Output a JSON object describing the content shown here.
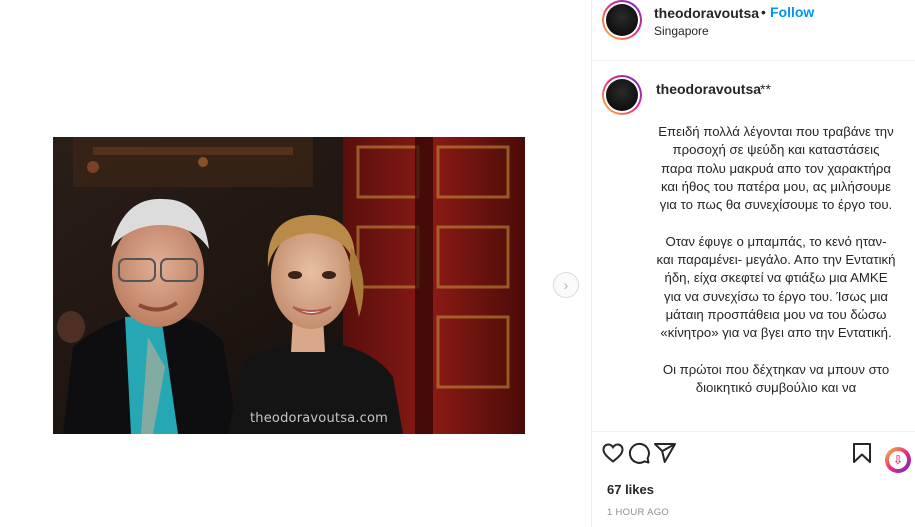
{
  "post": {
    "username": "theodoravoutsa",
    "follow_separator": "•",
    "follow_label": "Follow",
    "location": "Singapore",
    "photo_watermark": "theodoravoutsa.com",
    "next_arrow": "›"
  },
  "caption": {
    "username": "theodoravoutsa",
    "suffix": "**",
    "paragraphs": [
      "Επειδή πολλά λέγονται που τραβάνε την προσοχή σε ψεύδη και καταστάσεις παρα πολυ μακρυά απο τον χαρακτήρα και ήθος του πατέρα μου, ας μιλήσουμε για το πως θα συνεχίσουμε το έργο του.",
      "Οταν έφυγε ο μπαμπάς, το κενό ηταν- και παραμένει- μεγάλο. Απο την Εντατική ήδη, είχα σκεφτεί να φτιάξω μια ΑΜΚΕ για να συνεχίσω το έργο του. Ίσως μια μάταιη προσπάθεια μου να του δώσω «κίνητρο» για να βγει απο την Εντατική.",
      "Οι πρώτοι που δέχτηκαν να μπουν στο διοικητικό συμβούλιο και να"
    ]
  },
  "footer": {
    "likes": "67 likes",
    "time": "1 HOUR AGO"
  },
  "icons": {
    "like": "heart-icon",
    "comment": "comment-icon",
    "share": "send-icon",
    "save": "bookmark-icon",
    "extension": "download-icon"
  },
  "colors": {
    "link": "#0095f6",
    "text": "#262626",
    "muted": "#8e8e8e",
    "border": "#efefef"
  }
}
